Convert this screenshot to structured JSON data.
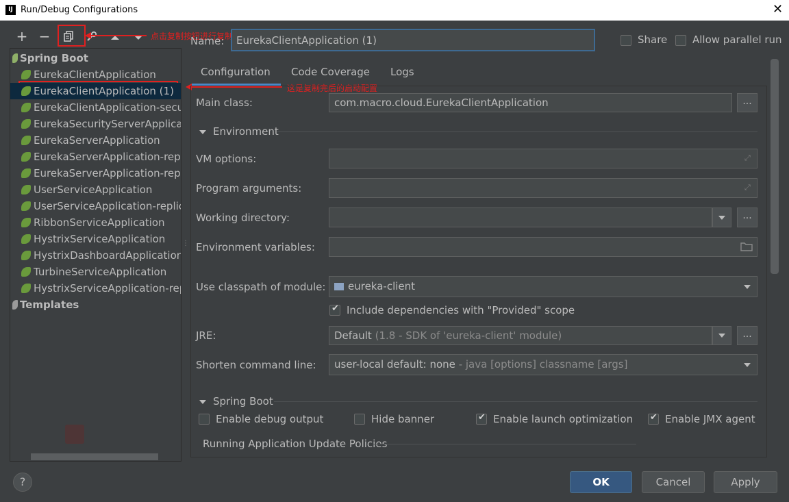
{
  "window": {
    "icon": "intellij-icon",
    "title": "Run/Debug Configurations",
    "close_glyph": "✕"
  },
  "toolbar": {
    "add": "+",
    "remove": "−",
    "copy_icon": "copy-icon",
    "edit_icon": "wrench-icon",
    "up_icon": "arrow-up-icon",
    "down_icon": "arrow-down-icon"
  },
  "annotations": {
    "copy_note": "点击复制按钮进行复制",
    "copied_note": "这是复制完后的启动配置"
  },
  "tree": {
    "groups": [
      {
        "label": "Spring Boot"
      },
      {
        "label": "Templates"
      }
    ],
    "items": [
      {
        "label": "EurekaClientApplication"
      },
      {
        "label": "EurekaClientApplication (1)"
      },
      {
        "label": "EurekaClientApplication-secu"
      },
      {
        "label": "EurekaSecurityServerApplicat"
      },
      {
        "label": "EurekaServerApplication"
      },
      {
        "label": "EurekaServerApplication-repl"
      },
      {
        "label": "EurekaServerApplication-repl"
      },
      {
        "label": "UserServiceApplication"
      },
      {
        "label": "UserServiceApplication-replic"
      },
      {
        "label": "RibbonServiceApplication"
      },
      {
        "label": "HystrixServiceApplication"
      },
      {
        "label": "HystrixDashboardApplication"
      },
      {
        "label": "TurbineServiceApplication"
      },
      {
        "label": "HystrixServiceApplication-rep"
      }
    ],
    "selected_index": 1
  },
  "header": {
    "name_label": "Name:",
    "name_value": "EurekaClientApplication (1)",
    "share_label": "Share",
    "share_checked": false,
    "parallel_label": "Allow parallel run",
    "parallel_checked": false
  },
  "tabs": [
    {
      "label": "Configuration",
      "active": true
    },
    {
      "label": "Code Coverage",
      "active": false
    },
    {
      "label": "Logs",
      "active": false
    }
  ],
  "form": {
    "main_class_label": "Main class:",
    "main_class_value": "com.macro.cloud.EurekaClientApplication",
    "environment_section": "Environment",
    "vm_options_label": "VM options:",
    "vm_options_value": "",
    "program_args_label": "Program arguments:",
    "program_args_value": "",
    "working_dir_label": "Working directory:",
    "working_dir_value": "",
    "env_vars_label": "Environment variables:",
    "env_vars_value": "",
    "classpath_label": "Use classpath of module:",
    "classpath_value": "eureka-client",
    "include_deps_label": "Include dependencies with \"Provided\" scope",
    "include_deps_checked": true,
    "jre_label": "JRE:",
    "jre_value": "Default",
    "jre_hint": "(1.8 - SDK of 'eureka-client' module)",
    "shorten_label": "Shorten command line:",
    "shorten_value": "user-local default: none",
    "shorten_hint": "- java [options] classname [args]",
    "browse_label": "...",
    "spring_boot_section": "Spring Boot",
    "debug_output_label": "Enable debug output",
    "debug_output_checked": false,
    "hide_banner_label": "Hide banner",
    "hide_banner_checked": false,
    "launch_opt_label": "Enable launch optimization",
    "launch_opt_checked": true,
    "jmx_label": "Enable JMX agent",
    "jmx_checked": true,
    "update_policies_label": "Running Application Update Policies"
  },
  "footer": {
    "help": "?",
    "ok": "OK",
    "cancel": "Cancel",
    "apply": "Apply"
  },
  "colors": {
    "background": "#3c3f41",
    "selection": "#0d293e",
    "accent": "#4a88c7",
    "annotation": "#e02020",
    "primary_button": "#365880"
  }
}
